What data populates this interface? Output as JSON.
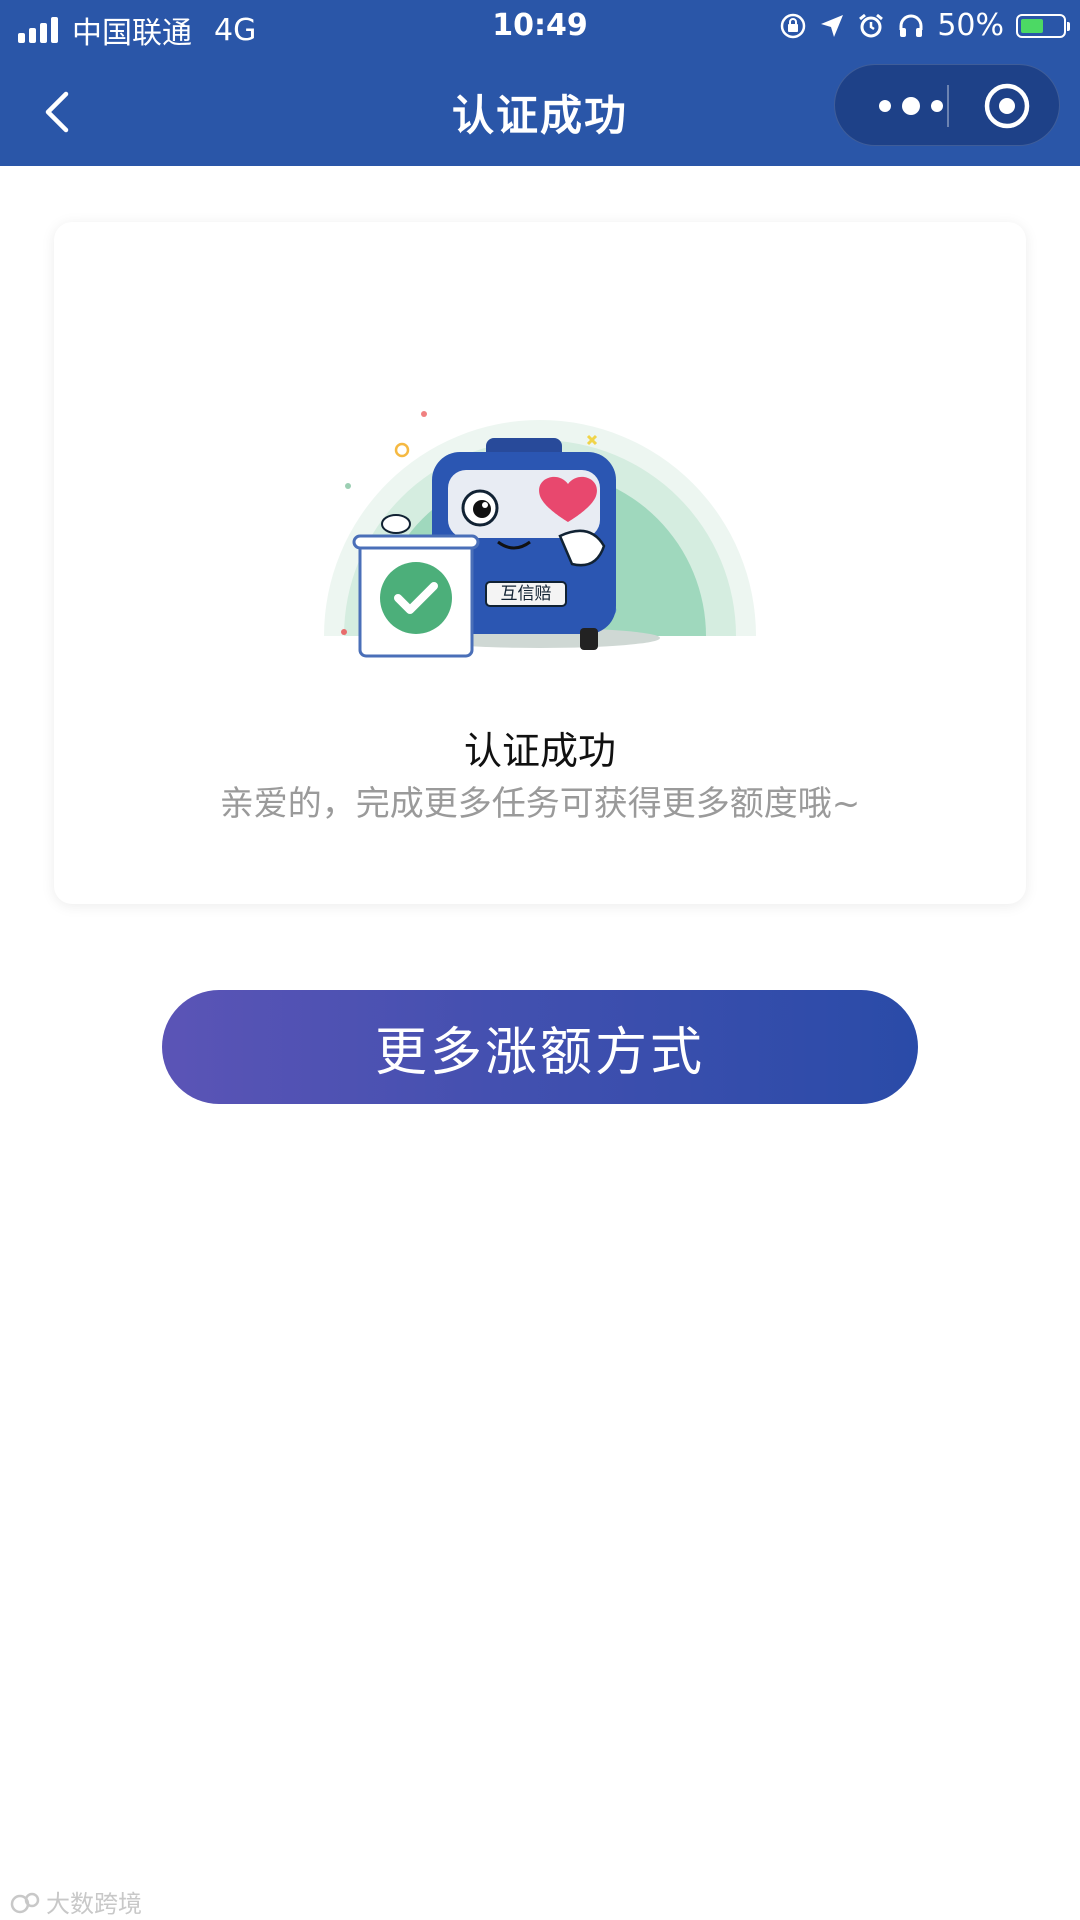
{
  "status_bar": {
    "carrier": "中国联通",
    "network": "4G",
    "time": "10:49",
    "battery": "50%",
    "battery_level": 0.5
  },
  "nav": {
    "title": "认证成功",
    "icons": [
      "back-icon",
      "more-icon",
      "target-icon"
    ]
  },
  "card": {
    "plate": "互信赔",
    "title": "认证成功",
    "subtitle": "亲爱的，完成更多任务可获得更多额度哦~"
  },
  "action": {
    "label": "更多涨额方式"
  },
  "watermark": {
    "text": "大数跨境"
  },
  "colors": {
    "header": "#2a56a8",
    "button_start": "#5b54b6",
    "button_end": "#2a4ba8",
    "check_green": "#4caf7a"
  }
}
